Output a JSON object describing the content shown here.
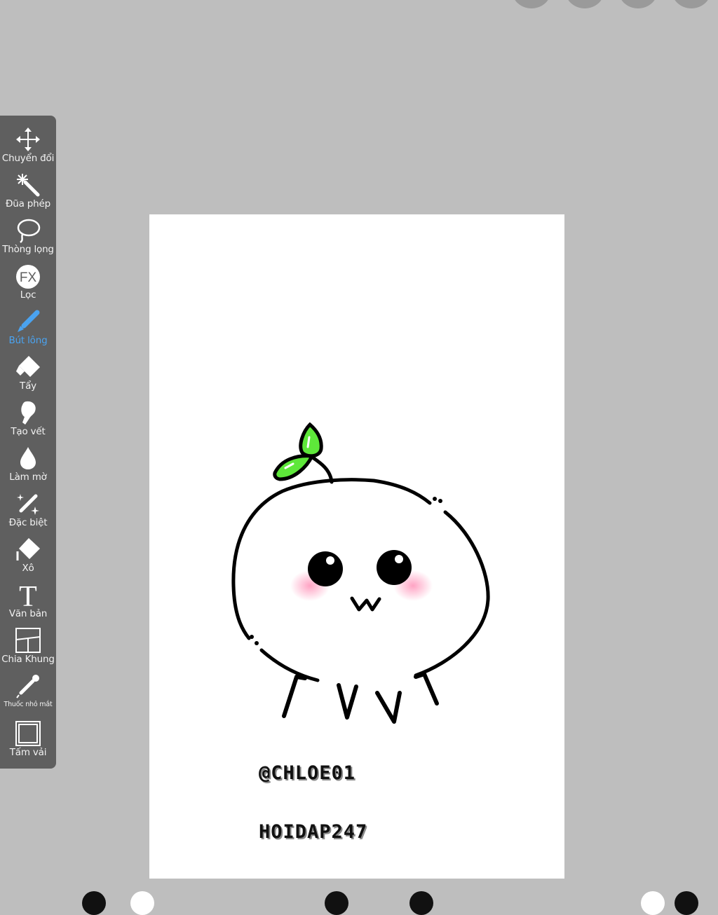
{
  "toolbar": {
    "tools": [
      {
        "label": "Chuyển đổi",
        "icon": "move-arrows-icon"
      },
      {
        "label": "Đũa phép",
        "icon": "magic-wand-icon"
      },
      {
        "label": "Thòng lọng",
        "icon": "lasso-icon"
      },
      {
        "label": "Lọc",
        "icon": "fx-filter-icon",
        "icon_text": "FX"
      },
      {
        "label": "Bút lông",
        "icon": "brush-icon",
        "active": true
      },
      {
        "label": "Tẩy",
        "icon": "eraser-icon"
      },
      {
        "label": "Tạo vết",
        "icon": "smudge-icon"
      },
      {
        "label": "Làm mờ",
        "icon": "blur-drop-icon"
      },
      {
        "label": "Đặc biệt",
        "icon": "special-sparkle-pen-icon"
      },
      {
        "label": "Xô",
        "icon": "paint-bucket-icon"
      },
      {
        "label": "Văn bản",
        "icon": "text-icon",
        "icon_text": "T"
      },
      {
        "label": "Chia Khung",
        "icon": "frame-divider-icon"
      },
      {
        "label": "Thuốc nhỏ mắt",
        "icon": "eyedropper-icon"
      },
      {
        "label": "Tấm vải",
        "icon": "canvas-icon"
      }
    ],
    "active_color": "#4aa3f0"
  },
  "canvas": {
    "watermark_1": "@CHLOE01",
    "watermark_2": "HOIDAP247",
    "leaf_color": "#5ee83a",
    "blush_color": "#ff9ec0"
  }
}
